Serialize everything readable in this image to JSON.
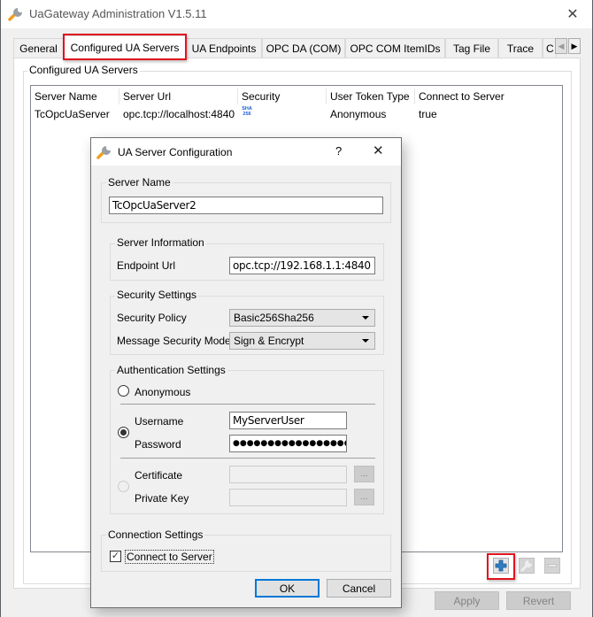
{
  "window": {
    "title": "UaGateway Administration V1.5.11",
    "close_glyph": "✕"
  },
  "tabs": [
    {
      "label": "General",
      "active": false
    },
    {
      "label": "Configured UA Servers",
      "active": true
    },
    {
      "label": "UA Endpoints",
      "active": false
    },
    {
      "label": "OPC DA (COM)",
      "active": false
    },
    {
      "label": "OPC COM ItemIDs",
      "active": false
    },
    {
      "label": "Tag File",
      "active": false
    },
    {
      "label": "Trace",
      "active": false
    },
    {
      "label": "C",
      "active": false
    }
  ],
  "tab_scroll": {
    "left_glyph": "◀",
    "right_glyph": "▶"
  },
  "servers_panel": {
    "group_label": "Configured UA Servers",
    "columns": [
      "Server Name",
      "Server Url",
      "Security",
      "User Token Type",
      "Connect to Server"
    ],
    "rows": [
      {
        "server_name": "TcOpcUaServer",
        "server_url": "opc.tcp://localhost:4840",
        "security_icon": "sha256-icon",
        "security_icon_text": [
          "SHA",
          "256"
        ],
        "user_token_type": "Anonymous",
        "connect_to_server": "true"
      }
    ],
    "toolbar": {
      "add": "add-server",
      "edit": "edit-server",
      "remove": "remove-server"
    }
  },
  "footer": {
    "apply_label": "Apply",
    "revert_label": "Revert"
  },
  "dialog": {
    "title": "UA Server Configuration",
    "help_glyph": "?",
    "close_glyph": "✕",
    "server_name": {
      "group_label": "Server Name",
      "value": "TcOpcUaServer2"
    },
    "server_information": {
      "group_label": "Server Information",
      "endpoint_url_label": "Endpoint Url",
      "endpoint_url_value": "opc.tcp://192.168.1.1:4840"
    },
    "security_settings": {
      "group_label": "Security Settings",
      "security_policy_label": "Security Policy",
      "security_policy_value": "Basic256Sha256",
      "message_security_mode_label": "Message Security Mode",
      "message_security_mode_value": "Sign & Encrypt"
    },
    "authentication_settings": {
      "group_label": "Authentication Settings",
      "selected": "username",
      "anonymous_label": "Anonymous",
      "username_label": "Username",
      "username_value": "MyServerUser",
      "password_label": "Password",
      "password_value": "●●●●●●●●●●●●●●●●●",
      "certificate_label": "Certificate",
      "certificate_value": "",
      "private_key_label": "Private Key",
      "private_key_value": "",
      "browse_label": "..."
    },
    "connection_settings": {
      "group_label": "Connection Settings",
      "connect_to_server_label": "Connect to Server",
      "connect_to_server_checked": true,
      "check_glyph": "✓"
    },
    "ok_label": "OK",
    "cancel_label": "Cancel"
  },
  "colors": {
    "highlight_red": "#e0141e",
    "default_button_blue": "#0078d7",
    "add_icon_blue": "#2f7dc4"
  }
}
